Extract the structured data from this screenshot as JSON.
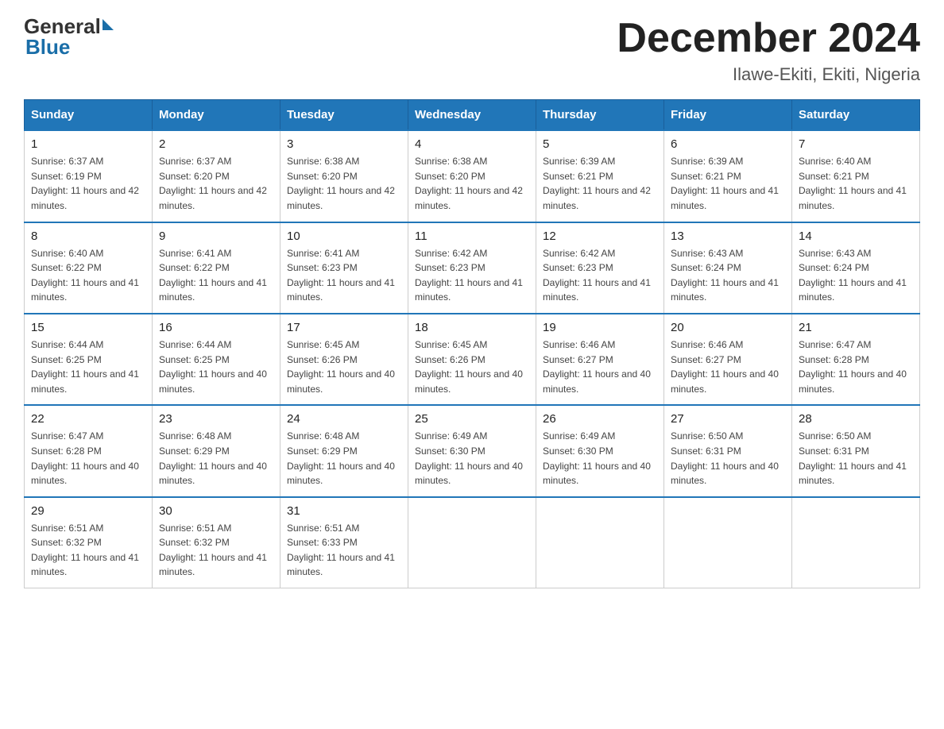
{
  "header": {
    "logo_general": "General",
    "logo_blue": "Blue",
    "main_title": "December 2024",
    "subtitle": "Ilawe-Ekiti, Ekiti, Nigeria"
  },
  "calendar": {
    "days_of_week": [
      "Sunday",
      "Monday",
      "Tuesday",
      "Wednesday",
      "Thursday",
      "Friday",
      "Saturday"
    ],
    "weeks": [
      [
        {
          "day": "1",
          "sunrise": "6:37 AM",
          "sunset": "6:19 PM",
          "daylight": "11 hours and 42 minutes."
        },
        {
          "day": "2",
          "sunrise": "6:37 AM",
          "sunset": "6:20 PM",
          "daylight": "11 hours and 42 minutes."
        },
        {
          "day": "3",
          "sunrise": "6:38 AM",
          "sunset": "6:20 PM",
          "daylight": "11 hours and 42 minutes."
        },
        {
          "day": "4",
          "sunrise": "6:38 AM",
          "sunset": "6:20 PM",
          "daylight": "11 hours and 42 minutes."
        },
        {
          "day": "5",
          "sunrise": "6:39 AM",
          "sunset": "6:21 PM",
          "daylight": "11 hours and 42 minutes."
        },
        {
          "day": "6",
          "sunrise": "6:39 AM",
          "sunset": "6:21 PM",
          "daylight": "11 hours and 41 minutes."
        },
        {
          "day": "7",
          "sunrise": "6:40 AM",
          "sunset": "6:21 PM",
          "daylight": "11 hours and 41 minutes."
        }
      ],
      [
        {
          "day": "8",
          "sunrise": "6:40 AM",
          "sunset": "6:22 PM",
          "daylight": "11 hours and 41 minutes."
        },
        {
          "day": "9",
          "sunrise": "6:41 AM",
          "sunset": "6:22 PM",
          "daylight": "11 hours and 41 minutes."
        },
        {
          "day": "10",
          "sunrise": "6:41 AM",
          "sunset": "6:23 PM",
          "daylight": "11 hours and 41 minutes."
        },
        {
          "day": "11",
          "sunrise": "6:42 AM",
          "sunset": "6:23 PM",
          "daylight": "11 hours and 41 minutes."
        },
        {
          "day": "12",
          "sunrise": "6:42 AM",
          "sunset": "6:23 PM",
          "daylight": "11 hours and 41 minutes."
        },
        {
          "day": "13",
          "sunrise": "6:43 AM",
          "sunset": "6:24 PM",
          "daylight": "11 hours and 41 minutes."
        },
        {
          "day": "14",
          "sunrise": "6:43 AM",
          "sunset": "6:24 PM",
          "daylight": "11 hours and 41 minutes."
        }
      ],
      [
        {
          "day": "15",
          "sunrise": "6:44 AM",
          "sunset": "6:25 PM",
          "daylight": "11 hours and 41 minutes."
        },
        {
          "day": "16",
          "sunrise": "6:44 AM",
          "sunset": "6:25 PM",
          "daylight": "11 hours and 40 minutes."
        },
        {
          "day": "17",
          "sunrise": "6:45 AM",
          "sunset": "6:26 PM",
          "daylight": "11 hours and 40 minutes."
        },
        {
          "day": "18",
          "sunrise": "6:45 AM",
          "sunset": "6:26 PM",
          "daylight": "11 hours and 40 minutes."
        },
        {
          "day": "19",
          "sunrise": "6:46 AM",
          "sunset": "6:27 PM",
          "daylight": "11 hours and 40 minutes."
        },
        {
          "day": "20",
          "sunrise": "6:46 AM",
          "sunset": "6:27 PM",
          "daylight": "11 hours and 40 minutes."
        },
        {
          "day": "21",
          "sunrise": "6:47 AM",
          "sunset": "6:28 PM",
          "daylight": "11 hours and 40 minutes."
        }
      ],
      [
        {
          "day": "22",
          "sunrise": "6:47 AM",
          "sunset": "6:28 PM",
          "daylight": "11 hours and 40 minutes."
        },
        {
          "day": "23",
          "sunrise": "6:48 AM",
          "sunset": "6:29 PM",
          "daylight": "11 hours and 40 minutes."
        },
        {
          "day": "24",
          "sunrise": "6:48 AM",
          "sunset": "6:29 PM",
          "daylight": "11 hours and 40 minutes."
        },
        {
          "day": "25",
          "sunrise": "6:49 AM",
          "sunset": "6:30 PM",
          "daylight": "11 hours and 40 minutes."
        },
        {
          "day": "26",
          "sunrise": "6:49 AM",
          "sunset": "6:30 PM",
          "daylight": "11 hours and 40 minutes."
        },
        {
          "day": "27",
          "sunrise": "6:50 AM",
          "sunset": "6:31 PM",
          "daylight": "11 hours and 40 minutes."
        },
        {
          "day": "28",
          "sunrise": "6:50 AM",
          "sunset": "6:31 PM",
          "daylight": "11 hours and 41 minutes."
        }
      ],
      [
        {
          "day": "29",
          "sunrise": "6:51 AM",
          "sunset": "6:32 PM",
          "daylight": "11 hours and 41 minutes."
        },
        {
          "day": "30",
          "sunrise": "6:51 AM",
          "sunset": "6:32 PM",
          "daylight": "11 hours and 41 minutes."
        },
        {
          "day": "31",
          "sunrise": "6:51 AM",
          "sunset": "6:33 PM",
          "daylight": "11 hours and 41 minutes."
        },
        null,
        null,
        null,
        null
      ]
    ]
  }
}
